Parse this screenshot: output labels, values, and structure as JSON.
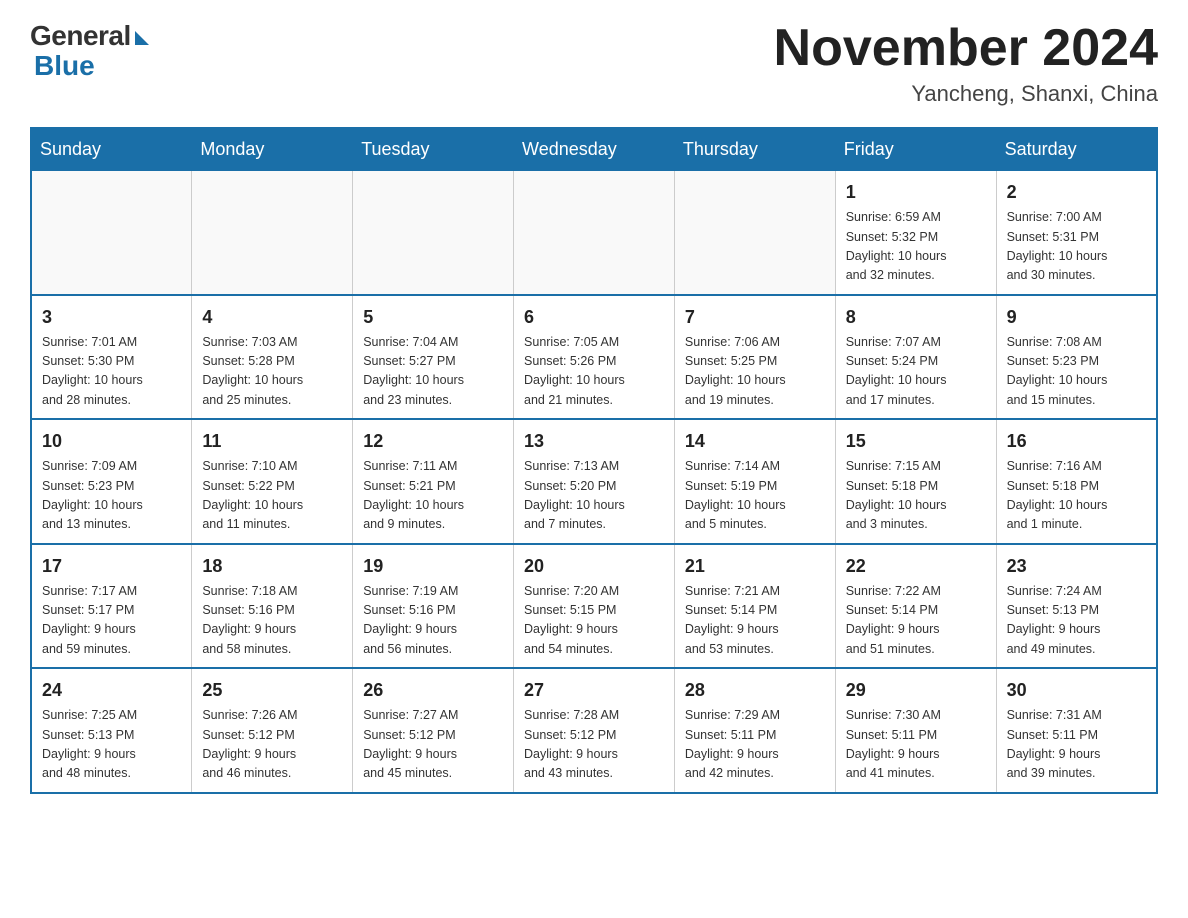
{
  "header": {
    "title": "November 2024",
    "location": "Yancheng, Shanxi, China",
    "logo_general": "General",
    "logo_blue": "Blue"
  },
  "weekdays": [
    "Sunday",
    "Monday",
    "Tuesday",
    "Wednesday",
    "Thursday",
    "Friday",
    "Saturday"
  ],
  "weeks": [
    [
      {
        "day": "",
        "info": ""
      },
      {
        "day": "",
        "info": ""
      },
      {
        "day": "",
        "info": ""
      },
      {
        "day": "",
        "info": ""
      },
      {
        "day": "",
        "info": ""
      },
      {
        "day": "1",
        "info": "Sunrise: 6:59 AM\nSunset: 5:32 PM\nDaylight: 10 hours\nand 32 minutes."
      },
      {
        "day": "2",
        "info": "Sunrise: 7:00 AM\nSunset: 5:31 PM\nDaylight: 10 hours\nand 30 minutes."
      }
    ],
    [
      {
        "day": "3",
        "info": "Sunrise: 7:01 AM\nSunset: 5:30 PM\nDaylight: 10 hours\nand 28 minutes."
      },
      {
        "day": "4",
        "info": "Sunrise: 7:03 AM\nSunset: 5:28 PM\nDaylight: 10 hours\nand 25 minutes."
      },
      {
        "day": "5",
        "info": "Sunrise: 7:04 AM\nSunset: 5:27 PM\nDaylight: 10 hours\nand 23 minutes."
      },
      {
        "day": "6",
        "info": "Sunrise: 7:05 AM\nSunset: 5:26 PM\nDaylight: 10 hours\nand 21 minutes."
      },
      {
        "day": "7",
        "info": "Sunrise: 7:06 AM\nSunset: 5:25 PM\nDaylight: 10 hours\nand 19 minutes."
      },
      {
        "day": "8",
        "info": "Sunrise: 7:07 AM\nSunset: 5:24 PM\nDaylight: 10 hours\nand 17 minutes."
      },
      {
        "day": "9",
        "info": "Sunrise: 7:08 AM\nSunset: 5:23 PM\nDaylight: 10 hours\nand 15 minutes."
      }
    ],
    [
      {
        "day": "10",
        "info": "Sunrise: 7:09 AM\nSunset: 5:23 PM\nDaylight: 10 hours\nand 13 minutes."
      },
      {
        "day": "11",
        "info": "Sunrise: 7:10 AM\nSunset: 5:22 PM\nDaylight: 10 hours\nand 11 minutes."
      },
      {
        "day": "12",
        "info": "Sunrise: 7:11 AM\nSunset: 5:21 PM\nDaylight: 10 hours\nand 9 minutes."
      },
      {
        "day": "13",
        "info": "Sunrise: 7:13 AM\nSunset: 5:20 PM\nDaylight: 10 hours\nand 7 minutes."
      },
      {
        "day": "14",
        "info": "Sunrise: 7:14 AM\nSunset: 5:19 PM\nDaylight: 10 hours\nand 5 minutes."
      },
      {
        "day": "15",
        "info": "Sunrise: 7:15 AM\nSunset: 5:18 PM\nDaylight: 10 hours\nand 3 minutes."
      },
      {
        "day": "16",
        "info": "Sunrise: 7:16 AM\nSunset: 5:18 PM\nDaylight: 10 hours\nand 1 minute."
      }
    ],
    [
      {
        "day": "17",
        "info": "Sunrise: 7:17 AM\nSunset: 5:17 PM\nDaylight: 9 hours\nand 59 minutes."
      },
      {
        "day": "18",
        "info": "Sunrise: 7:18 AM\nSunset: 5:16 PM\nDaylight: 9 hours\nand 58 minutes."
      },
      {
        "day": "19",
        "info": "Sunrise: 7:19 AM\nSunset: 5:16 PM\nDaylight: 9 hours\nand 56 minutes."
      },
      {
        "day": "20",
        "info": "Sunrise: 7:20 AM\nSunset: 5:15 PM\nDaylight: 9 hours\nand 54 minutes."
      },
      {
        "day": "21",
        "info": "Sunrise: 7:21 AM\nSunset: 5:14 PM\nDaylight: 9 hours\nand 53 minutes."
      },
      {
        "day": "22",
        "info": "Sunrise: 7:22 AM\nSunset: 5:14 PM\nDaylight: 9 hours\nand 51 minutes."
      },
      {
        "day": "23",
        "info": "Sunrise: 7:24 AM\nSunset: 5:13 PM\nDaylight: 9 hours\nand 49 minutes."
      }
    ],
    [
      {
        "day": "24",
        "info": "Sunrise: 7:25 AM\nSunset: 5:13 PM\nDaylight: 9 hours\nand 48 minutes."
      },
      {
        "day": "25",
        "info": "Sunrise: 7:26 AM\nSunset: 5:12 PM\nDaylight: 9 hours\nand 46 minutes."
      },
      {
        "day": "26",
        "info": "Sunrise: 7:27 AM\nSunset: 5:12 PM\nDaylight: 9 hours\nand 45 minutes."
      },
      {
        "day": "27",
        "info": "Sunrise: 7:28 AM\nSunset: 5:12 PM\nDaylight: 9 hours\nand 43 minutes."
      },
      {
        "day": "28",
        "info": "Sunrise: 7:29 AM\nSunset: 5:11 PM\nDaylight: 9 hours\nand 42 minutes."
      },
      {
        "day": "29",
        "info": "Sunrise: 7:30 AM\nSunset: 5:11 PM\nDaylight: 9 hours\nand 41 minutes."
      },
      {
        "day": "30",
        "info": "Sunrise: 7:31 AM\nSunset: 5:11 PM\nDaylight: 9 hours\nand 39 minutes."
      }
    ]
  ]
}
